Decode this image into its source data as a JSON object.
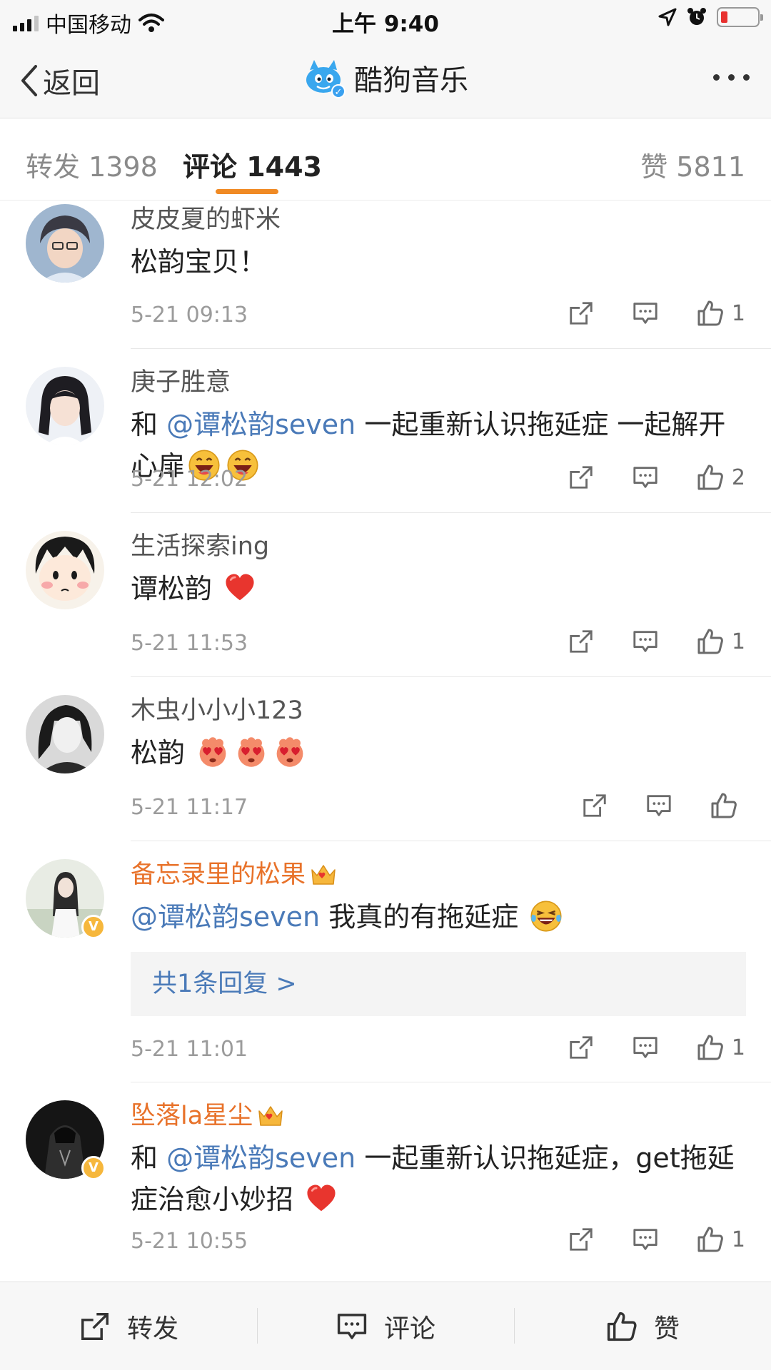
{
  "status_bar": {
    "carrier": "中国移动",
    "time": "上午 9:40",
    "battery_level": 0.12
  },
  "nav": {
    "back_label": "返回",
    "title": "酷狗音乐"
  },
  "tabs": {
    "repost": "转发 1398",
    "comment": "评论 1443",
    "like": "赞 5811",
    "active": "comment"
  },
  "comments": [
    {
      "username": "皮皮夏的虾米",
      "text": "松韵宝贝！",
      "time": "5-21 09:13",
      "likes": "1"
    },
    {
      "username": "庚子胜意",
      "text_pre": "和 ",
      "mention": "@谭松韵seven",
      "text_post": " 一起重新认识拖延症 一起解开心扉",
      "emojis": [
        "grin-emoji",
        "grin-emoji"
      ],
      "time": "5-21 12:02",
      "likes": "2"
    },
    {
      "username": "生活探索ing",
      "text": "谭松韵",
      "emojis": [
        "heart-emoji"
      ],
      "time": "5-21 11:53",
      "likes": "1"
    },
    {
      "username": "木虫小小小123",
      "text": "松韵",
      "emojis": [
        "heart-eyes-emoji",
        "heart-eyes-emoji",
        "heart-eyes-emoji"
      ],
      "time": "5-21 11:17",
      "likes": ""
    },
    {
      "username": "备忘录里的松果",
      "mention": "@谭松韵seven",
      "text_post": " 我真的有拖延症",
      "emojis": [
        "laugh-cry-emoji"
      ],
      "reply_label": "共1条回复 >",
      "time": "5-21 11:01",
      "likes": "1"
    },
    {
      "username": "坠落la星尘",
      "text_pre": "和 ",
      "mention": "@谭松韵seven",
      "text_post": " 一起重新认识拖延症，get拖延症治愈小妙招",
      "emojis": [
        "heart-emoji"
      ],
      "time": "5-21 10:55",
      "likes": "1"
    }
  ],
  "bottom_bar": {
    "repost": "转发",
    "comment": "评论",
    "like": "赞"
  },
  "colors": {
    "accent": "#f08a24",
    "mention": "#4a7ab8",
    "vip_name": "#e8722a"
  }
}
